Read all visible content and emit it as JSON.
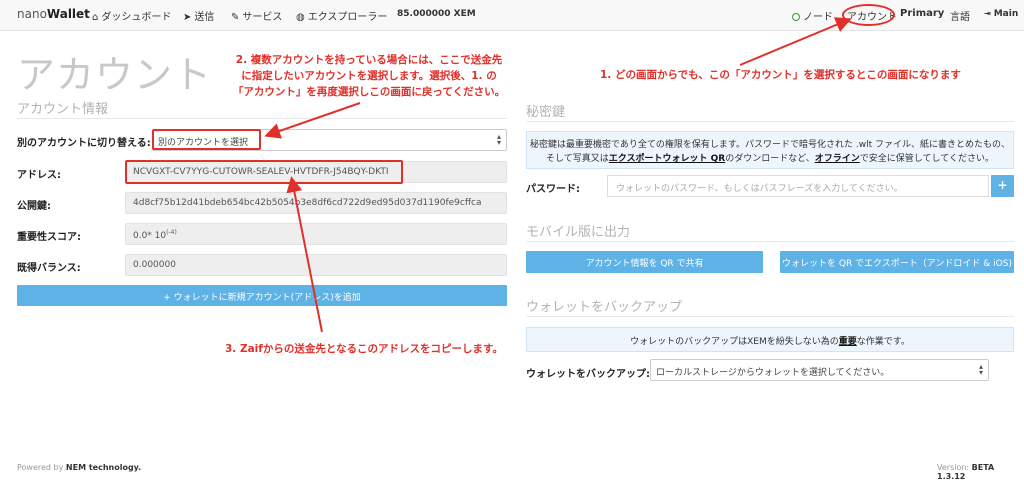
{
  "nav": {
    "brand_prefix": "nano",
    "brand_suffix": "Wallet",
    "dashboard": "ダッシュボード",
    "send": "送信",
    "services": "サービス",
    "explorer": "エクスプローラー",
    "balance": "85.000000 XEM",
    "node": "ノード",
    "account": "アカウント",
    "account_name": "Primary",
    "language": "言語",
    "main": "Main"
  },
  "left": {
    "page_title": "アカウント",
    "section_title": "アカウント情報",
    "switch_label": "別のアカウントに切り替える:",
    "switch_value": "別のアカウントを選択",
    "address_label": "アドレス:",
    "address_value": "NCVGXT-CV7YYG-CUTOWR-SEALEV-HVTDFR-J54BQY-DKTI",
    "pubkey_label": "公開鍵:",
    "pubkey_value": "4d8cf75b12d41bdeb654bc42b5054b3e8df6cd722d9ed95d037d1190fe9cffca",
    "importance_label": "重要性スコア:",
    "importance_value": "0.0* 10",
    "importance_exp": "(-4)",
    "vested_label": "既得バランス:",
    "vested_value": "0.000000",
    "add_account_button": "+ ウォレットに新規アカウント(アドレス)を追加"
  },
  "right": {
    "secret_title": "秘密鍵",
    "secret_info_1": "秘密鍵は最重要機密であり全ての権限を保有します。パスワードで暗号化された .wlt ファイル、紙に書きとめたもの、",
    "secret_info_2a": "そして写真又は",
    "secret_info_2b": "エクスポートウォレット QR",
    "secret_info_2c": "のダウンロードなど、",
    "secret_info_2d": "オフライン",
    "secret_info_2e": "で安全に保管してしてください。",
    "password_label": "パスワード:",
    "password_placeholder": "ウォレットのパスワード、もしくはパスフレーズを入力してください。",
    "plus": "+",
    "mobile_title": "モバイル版に出力",
    "share_qr_button": "アカウント情報を QR で共有",
    "export_qr_button": "ウォレットを QR でエクスポート（アンドロイド & iOS)",
    "backup_title": "ウォレットをバックアップ",
    "backup_info_a": "ウォレットのバックアップはXEMを紛失しない為の",
    "backup_info_b": "重要",
    "backup_info_c": "な作業です。",
    "backup_label": "ウォレットをバックアップ:",
    "backup_select": "ローカルストレージからウォレットを選択してください。"
  },
  "annotations": {
    "note1": "1. どの画面からでも、この「アカウント」を選択するとこの画面になります",
    "note2_l1": "2. 複数アカウントを持っている場合には、ここで送金先",
    "note2_l2": "に指定したいアカウントを選択します。選択後、1. の",
    "note2_l3": "「アカウント」を再度選択しこの画面に戻ってください。",
    "note3": "3. Zaifからの送金先となるこのアドレスをコピーします。"
  },
  "footer": {
    "powered_prefix": "Powered by ",
    "powered_by": "NEM technology.",
    "version_prefix": "Version: ",
    "version": "BETA 1.3.12"
  },
  "colors": {
    "accent": "#5fb2e6",
    "annotation": "#e0302a",
    "node_status": "#3a9b3a"
  }
}
